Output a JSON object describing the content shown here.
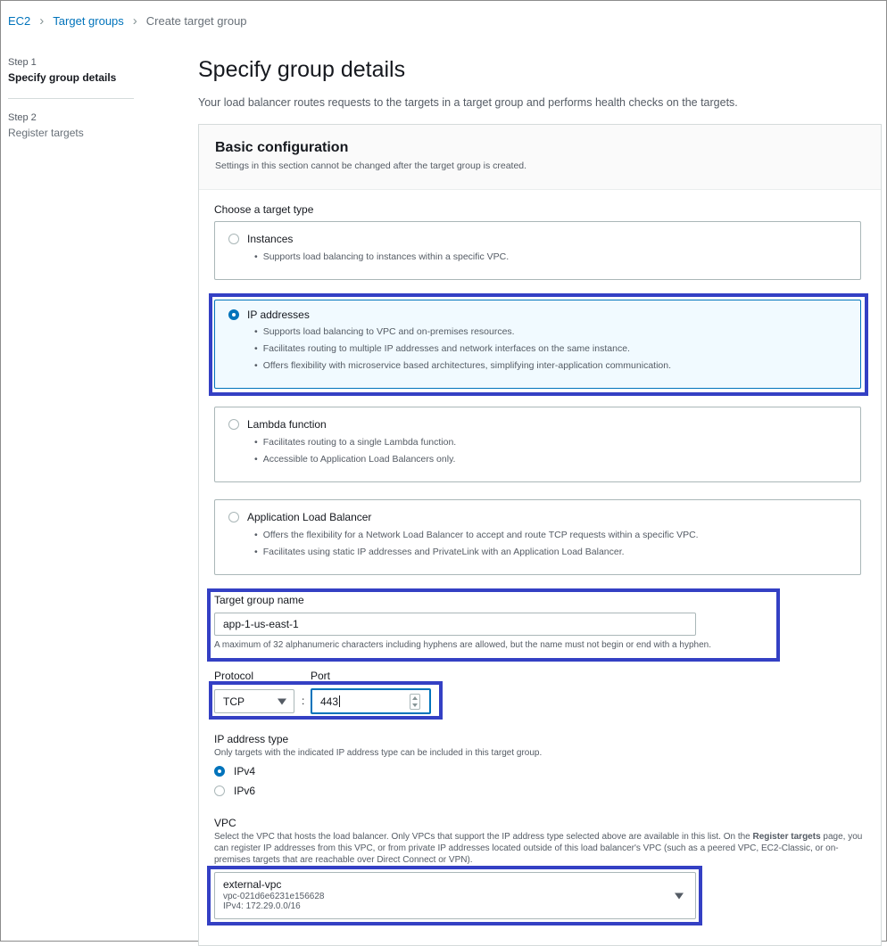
{
  "breadcrumb": {
    "items": [
      {
        "label": "EC2"
      },
      {
        "label": "Target groups"
      },
      {
        "label": "Create target group"
      }
    ]
  },
  "wizard": {
    "steps": [
      {
        "number": "Step 1",
        "title": "Specify group details",
        "active": true
      },
      {
        "number": "Step 2",
        "title": "Register targets",
        "active": false
      }
    ]
  },
  "page": {
    "title": "Specify group details",
    "description": "Your load balancer routes requests to the targets in a target group and performs health checks on the targets."
  },
  "basic_config": {
    "title": "Basic configuration",
    "subtitle": "Settings in this section cannot be changed after the target group is created.",
    "target_type_label": "Choose a target type",
    "target_types": [
      {
        "title": "Instances",
        "selected": false,
        "bullets": [
          "Supports load balancing to instances within a specific VPC."
        ]
      },
      {
        "title": "IP addresses",
        "selected": true,
        "bullets": [
          "Supports load balancing to VPC and on-premises resources.",
          "Facilitates routing to multiple IP addresses and network interfaces on the same instance.",
          "Offers flexibility with microservice based architectures, simplifying inter-application communication."
        ]
      },
      {
        "title": "Lambda function",
        "selected": false,
        "bullets": [
          "Facilitates routing to a single Lambda function.",
          "Accessible to Application Load Balancers only."
        ]
      },
      {
        "title": "Application Load Balancer",
        "selected": false,
        "bullets": [
          "Offers the flexibility for a Network Load Balancer to accept and route TCP requests within a specific VPC.",
          "Facilitates using static IP addresses and PrivateLink with an Application Load Balancer."
        ]
      }
    ]
  },
  "target_group_name": {
    "label": "Target group name",
    "value": "app-1-us-east-1",
    "hint": "A maximum of 32 alphanumeric characters including hyphens are allowed, but the name must not begin or end with a hyphen."
  },
  "protocol": {
    "label": "Protocol",
    "value": "TCP"
  },
  "port": {
    "label": "Port",
    "separator": ":",
    "value": "443"
  },
  "ip_address_type": {
    "label": "IP address type",
    "hint": "Only targets with the indicated IP address type can be included in this target group.",
    "options": [
      {
        "label": "IPv4",
        "selected": true
      },
      {
        "label": "IPv6",
        "selected": false
      }
    ]
  },
  "vpc": {
    "label": "VPC",
    "hint_1": "Select the VPC that hosts the load balancer. Only VPCs that support the IP address type selected above are available in this list. On the ",
    "hint_bold_1": "Register targets",
    "hint_2": " page, you can register IP addresses from this VPC, or from private IP addresses located outside of this load balancer's VPC (such as a peered VPC, EC2-Classic, or on-premises targets that are reachable over Direct Connect or VPN).",
    "selected_name": "external-vpc",
    "selected_id": "vpc-021d6e6231e156628",
    "selected_cidr": "IPv4: 172.29.0.0/16"
  },
  "theme": {
    "accent": "#0073bb",
    "highlight_border": "#3440c4",
    "selected_tile_bg": "#f1faff"
  }
}
